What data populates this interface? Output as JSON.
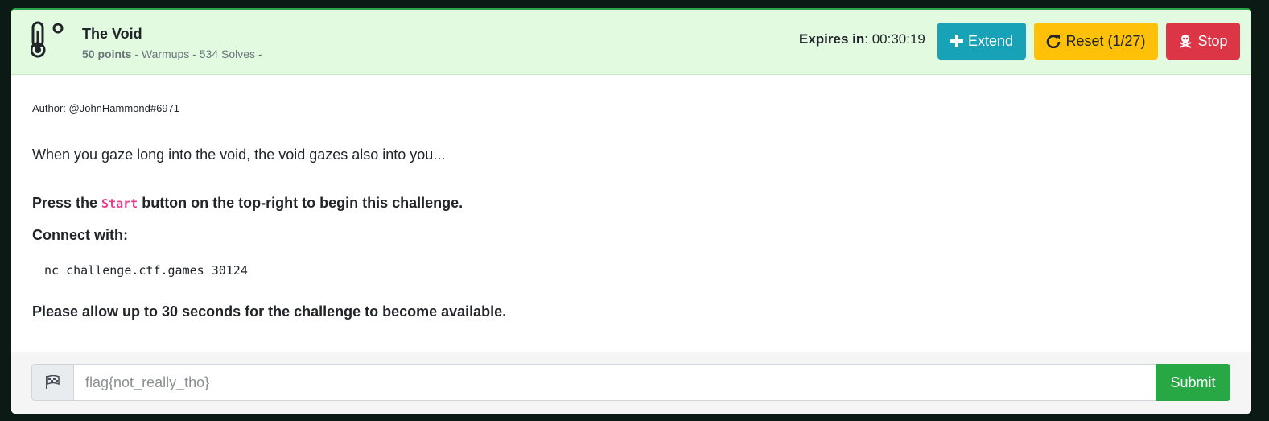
{
  "challenge": {
    "icon": "thermometer-icon",
    "title": "The Void",
    "points": "50 points",
    "meta": " - Warmups - 534 Solves -"
  },
  "timer": {
    "label": "Expires in",
    "value": ": 00:30:19"
  },
  "actions": {
    "extend_label": "Extend",
    "reset_label": "Reset (1/27)",
    "stop_label": "Stop"
  },
  "description": {
    "author": "Author: @JohnHammond#6971",
    "text": "When you gaze long into the void, the void gazes also into you...",
    "press_prefix": "Press the ",
    "press_code": "Start",
    "press_suffix": " button on the top-right to begin this challenge.",
    "connect_label": "Connect with:",
    "command": "nc challenge.ctf.games 30124",
    "allow_text": "Please allow up to 30 seconds for the challenge to become available."
  },
  "submission": {
    "flag_icon": "checkered-flag-icon",
    "placeholder": "flag{not_really_tho}",
    "submit_label": "Submit"
  },
  "colors": {
    "header_bg": "#e2fbe0",
    "extend": "#17a2b8",
    "reset": "#ffc107",
    "stop": "#dc3545",
    "submit": "#28a745",
    "code": "#e83e8c"
  }
}
